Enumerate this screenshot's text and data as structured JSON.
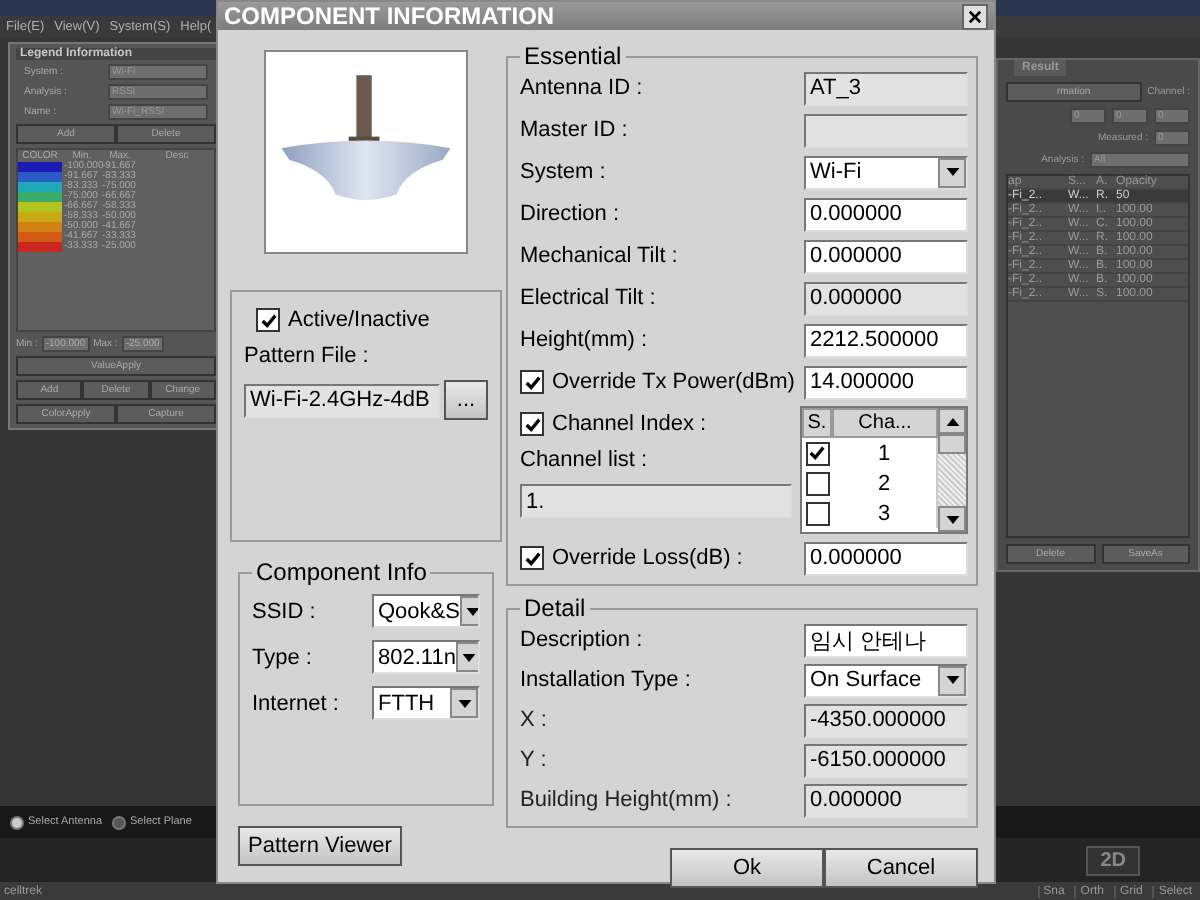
{
  "app": {
    "menu": [
      "File(E)",
      "View(V)",
      "System(S)",
      "Help("
    ]
  },
  "legend_panel": {
    "title": "Legend Information",
    "fields": [
      {
        "label": "System :",
        "value": "Wi-Fi"
      },
      {
        "label": "Analysis :",
        "value": "RSSI"
      },
      {
        "label": "Name :",
        "value": "Wi-Fi_RSSI"
      }
    ],
    "buttons_top": [
      "Add",
      "Delete"
    ],
    "columns": [
      "COLOR",
      "Min.",
      "Max.",
      "Desc"
    ],
    "rows": [
      {
        "color": "#1a1ab4",
        "min": "-100.000",
        "max": "-91.667"
      },
      {
        "color": "#2a5cc8",
        "min": "-91.667",
        "max": "-83.333"
      },
      {
        "color": "#1fa8b8",
        "min": "-83.333",
        "max": "-75.000"
      },
      {
        "color": "#3cab6a",
        "min": "-75.000",
        "max": "-66.667"
      },
      {
        "color": "#b4c41e",
        "min": "-66.667",
        "max": "-58.333"
      },
      {
        "color": "#c8a814",
        "min": "-58.333",
        "max": "-50.000"
      },
      {
        "color": "#d28214",
        "min": "-50.000",
        "max": "-41.667"
      },
      {
        "color": "#d25a14",
        "min": "-41.667",
        "max": "-33.333"
      },
      {
        "color": "#c8281e",
        "min": "-33.333",
        "max": "-25.000"
      }
    ],
    "min_label": "Min :",
    "min_value": "-100.000",
    "max_label": "Max :",
    "max_value": "-25.000",
    "value_apply": "ValueApply",
    "buttons_mid": [
      "Add",
      "Delete",
      "Change"
    ],
    "buttons_bottom": [
      "ColorApply",
      "Capture"
    ]
  },
  "result_panel": {
    "tab": "Result",
    "info_button": "rmation",
    "channel_label": "Channel :",
    "range_values": [
      "0",
      "0",
      "0"
    ],
    "measured_label": "Measured :",
    "measured_value": "0",
    "analysis_label": "Analysis :",
    "analysis_value": "All",
    "columns": [
      "ap",
      "S...",
      "A.",
      "Opacity"
    ],
    "rows": [
      {
        "cells": [
          "-Fi_2..",
          "W...",
          "R.",
          "50"
        ],
        "selected": true
      },
      {
        "cells": [
          "-Fi_2..",
          "W...",
          "I..",
          "100.00"
        ],
        "selected": false
      },
      {
        "cells": [
          "-Fi_2..",
          "W...",
          "C.",
          "100.00"
        ],
        "selected": false
      },
      {
        "cells": [
          "-Fi_2..",
          "W...",
          "R.",
          "100.00"
        ],
        "selected": false
      },
      {
        "cells": [
          "-Fi_2..",
          "W...",
          "B.",
          "100.00"
        ],
        "selected": false
      },
      {
        "cells": [
          "-Fi_2..",
          "W...",
          "B.",
          "100.00"
        ],
        "selected": false
      },
      {
        "cells": [
          "-Fi_2..",
          "W...",
          "B.",
          "100.00"
        ],
        "selected": false
      },
      {
        "cells": [
          "-Fi_2..",
          "W...",
          "S.",
          "100.00"
        ],
        "selected": false
      }
    ],
    "buttons": [
      "Delete",
      "SaveAs"
    ]
  },
  "select_bar": [
    {
      "label": "Select Antenna",
      "selected": true
    },
    {
      "label": "Select Plane",
      "selected": false
    }
  ],
  "view_button": "2D",
  "status_bar": {
    "left": "celltrek",
    "items": [
      "Sna",
      "Orth",
      "Grid",
      "Select"
    ]
  },
  "dialog": {
    "title": "COMPONENT INFORMATION",
    "active": {
      "label": "Active/Inactive",
      "checked": true
    },
    "pattern_file": {
      "label": "Pattern File :",
      "value": "Wi-Fi-2.4GHz-4dB",
      "button": "..."
    },
    "component_info": {
      "title": "Component Info",
      "fields": [
        {
          "label": "SSID :",
          "value": "Qook&S"
        },
        {
          "label": "Type :",
          "value": "802.11n"
        },
        {
          "label": "Internet :",
          "value": "FTTH"
        }
      ]
    },
    "pattern_viewer": "Pattern Viewer",
    "essential": {
      "title": "Essential",
      "rows": [
        {
          "kind": "readonly",
          "label": "Antenna ID :",
          "value": "AT_3"
        },
        {
          "kind": "readonly",
          "label": "Master ID :"
        },
        {
          "kind": "select",
          "label": "System :",
          "value": "Wi-Fi"
        },
        {
          "kind": "input",
          "label": "Direction :",
          "value": "0.000000"
        },
        {
          "kind": "input",
          "label": "Mechanical Tilt :",
          "value": "0.000000"
        },
        {
          "kind": "readonly",
          "label": "Electrical Tilt :",
          "value": "0.000000"
        },
        {
          "kind": "input",
          "label": "Height(mm) :",
          "value": "2212.500000"
        },
        {
          "kind": "check",
          "label": "Override Tx Power(dBm)",
          "checked": true,
          "value": "14.000000"
        }
      ],
      "channel": {
        "label": "Channel Index :",
        "checked": true,
        "list_label": "Channel list :",
        "list_value": "1.",
        "columns": [
          "S.",
          "Cha..."
        ],
        "rows": [
          {
            "number": "1",
            "checked": true
          },
          {
            "number": "2",
            "checked": false
          },
          {
            "number": "3",
            "checked": false
          }
        ]
      },
      "override_loss": {
        "label": "Override Loss(dB) :",
        "checked": true,
        "value": "0.000000"
      }
    },
    "detail": {
      "title": "Detail",
      "rows": [
        {
          "kind": "input",
          "label": "Description :",
          "value": "임시 안테나"
        },
        {
          "kind": "select",
          "label": "Installation Type :",
          "value": "On Surface"
        },
        {
          "kind": "readonly",
          "label": "X :",
          "value": "-4350.000000"
        },
        {
          "kind": "readonly",
          "label": "Y :",
          "value": "-6150.000000"
        },
        {
          "kind": "readonly",
          "label": "Building Height(mm) :",
          "value": "0.000000"
        }
      ]
    },
    "buttons": [
      "Ok",
      "Cancel"
    ]
  }
}
